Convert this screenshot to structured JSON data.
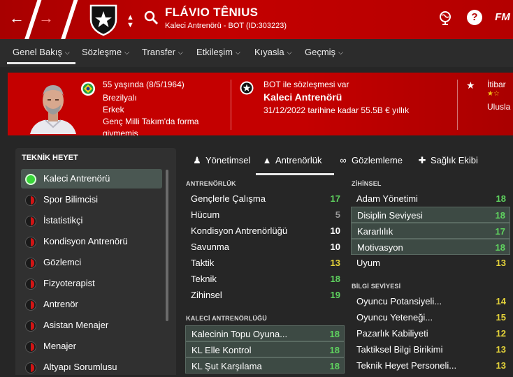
{
  "header": {
    "name": "FLÁVIO TÊNIUS",
    "subtitle": "Kaleci Antrenörü - BOT (ID:303223)",
    "fm_label": "FM",
    "help_label": "?"
  },
  "nav_tabs": [
    {
      "label": "Genel Bakış"
    },
    {
      "label": "Sözleşme"
    },
    {
      "label": "Transfer"
    },
    {
      "label": "Etkileşim"
    },
    {
      "label": "Kıyasla"
    },
    {
      "label": "Geçmiş"
    }
  ],
  "banner": {
    "age": "55 yaşında (8/5/1964)",
    "nationality": "Brezilyalı",
    "gender": "Erkek",
    "caps": "Genç Milli Takım'da forma",
    "caps_cont": "giymemiş",
    "contract_line": "BOT ile sözleşmesi var",
    "role": "Kaleci Antrenörü",
    "wage": "31/12/2022 tarihine kadar 55.5B € yıllık",
    "rep_label": "İtibar",
    "rep_value": "Ulusla"
  },
  "staff_panel": {
    "title": "TEKNİK HEYET",
    "items": [
      {
        "label": "Kaleci Antrenörü"
      },
      {
        "label": "Spor Bilimcisi"
      },
      {
        "label": "İstatistikçi"
      },
      {
        "label": "Kondisyon Antrenörü"
      },
      {
        "label": "Gözlemci"
      },
      {
        "label": "Fizyoterapist"
      },
      {
        "label": "Antrenör"
      },
      {
        "label": "Asistan Menajer"
      },
      {
        "label": "Menajer"
      },
      {
        "label": "Altyapı Sorumlusu"
      }
    ]
  },
  "attr_tabs": [
    {
      "label": "Yönetimsel"
    },
    {
      "label": "Antrenörlük"
    },
    {
      "label": "Gözlemleme"
    },
    {
      "label": "Sağlık Ekibi"
    }
  ],
  "coaching": {
    "title": "ANTRENÖRLÜK",
    "rows": [
      {
        "name": "Gençlerle Çalışma",
        "value": "17"
      },
      {
        "name": "Hücum",
        "value": "5"
      },
      {
        "name": "Kondisyon Antrenörlüğü",
        "value": "10"
      },
      {
        "name": "Savunma",
        "value": "10"
      },
      {
        "name": "Taktik",
        "value": "13"
      },
      {
        "name": "Teknik",
        "value": "18"
      },
      {
        "name": "Zihinsel",
        "value": "19"
      }
    ]
  },
  "gk_coaching": {
    "title": "KALECİ ANTRENÖRLÜĞÜ",
    "rows": [
      {
        "name": "Kalecinin Topu Oyuna...",
        "value": "18"
      },
      {
        "name": "KL Elle Kontrol",
        "value": "18"
      },
      {
        "name": "KL Şut Karşılama",
        "value": "18"
      }
    ]
  },
  "mental": {
    "title": "ZİHİNSEL",
    "rows": [
      {
        "name": "Adam Yönetimi",
        "value": "18"
      },
      {
        "name": "Disiplin Seviyesi",
        "value": "18"
      },
      {
        "name": "Kararlılık",
        "value": "17"
      },
      {
        "name": "Motivasyon",
        "value": "18"
      },
      {
        "name": "Uyum",
        "value": "13"
      }
    ]
  },
  "knowledge": {
    "title": "BİLGİ SEVİYESİ",
    "rows": [
      {
        "name": "Oyuncu Potansiyeli...",
        "value": "14"
      },
      {
        "name": "Oyuncu Yeteneği...",
        "value": "15"
      },
      {
        "name": "Pazarlık Kabiliyeti",
        "value": "12"
      },
      {
        "name": "Taktiksel Bilgi Birikimi",
        "value": "13"
      },
      {
        "name": "Teknik Heyet Personeli...",
        "value": "13"
      }
    ]
  },
  "colors": {
    "header_red": "#b30000",
    "banner_red": "#c40000",
    "background": "#262626",
    "highlight_row": "#3d4a44",
    "value_green": "#5fd35f",
    "value_yellow": "#e3d23a"
  }
}
